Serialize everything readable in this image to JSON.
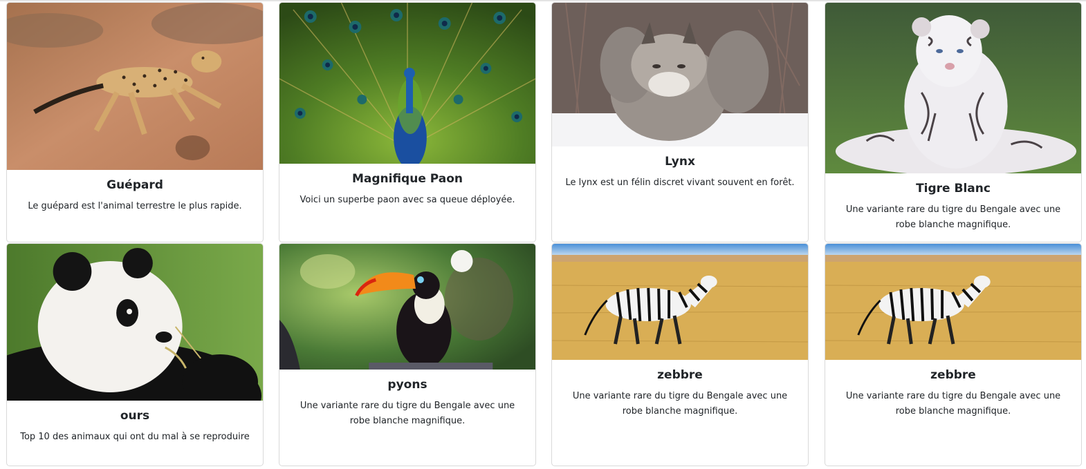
{
  "cards": [
    {
      "title": "Guépard",
      "text": "Le guépard est l'animal terrestre le plus rapide.",
      "image_icon": "cheetah-photo"
    },
    {
      "title": "Magnifique Paon",
      "text": "Voici un superbe paon avec sa queue déployée.",
      "image_icon": "peacock-photo"
    },
    {
      "title": "Lynx",
      "text": "Le lynx est un félin discret vivant souvent en forêt.",
      "image_icon": "lynx-photo"
    },
    {
      "title": "Tigre Blanc",
      "text": "Une variante rare du tigre du Bengale avec une robe blanche magnifique.",
      "image_icon": "white-tiger-photo"
    },
    {
      "title": "ours",
      "text": "Top 10 des animaux qui ont du mal à se reproduire",
      "image_icon": "panda-photo"
    },
    {
      "title": "pyons",
      "text": "Une variante rare du tigre du Bengale avec une robe blanche magnifique.",
      "image_icon": "toucan-photo"
    },
    {
      "title": "zebbre",
      "text": "Une variante rare du tigre du Bengale avec une robe blanche magnifique.",
      "image_icon": "zebra-photo"
    },
    {
      "title": "zebbre",
      "text": "Une variante rare du tigre du Bengale avec une robe blanche magnifique.",
      "image_icon": "zebra-photo"
    }
  ]
}
